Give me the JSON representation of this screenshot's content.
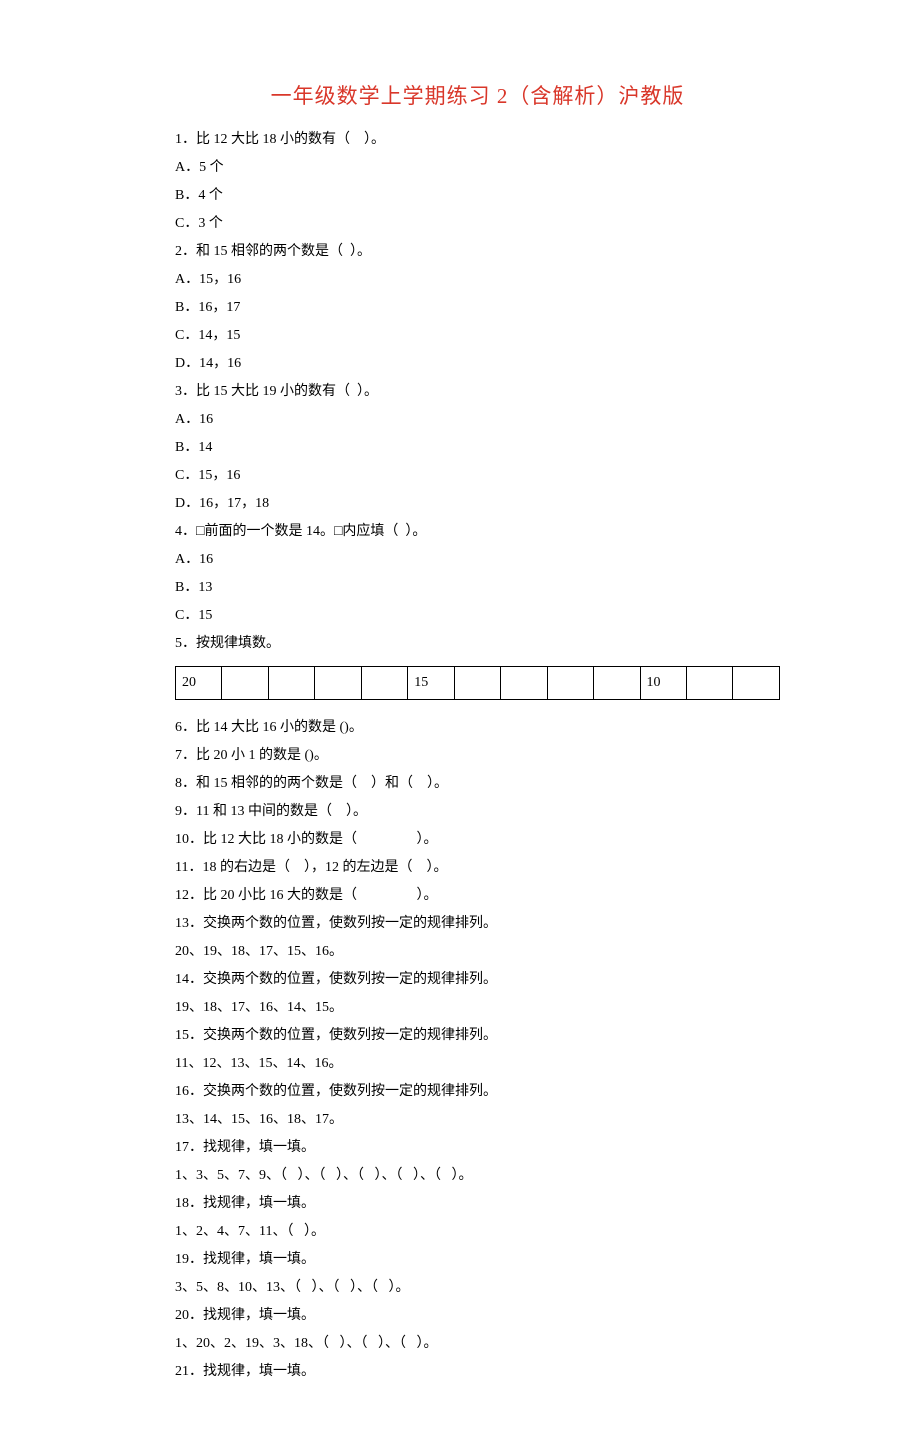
{
  "title": "一年级数学上学期练习 2（含解析）沪教版",
  "q1": {
    "stem": "1．比 12 大比 18 小的数有（    ）。",
    "a": "A．5 个",
    "b": "B．4 个",
    "c": "C．3 个"
  },
  "q2": {
    "stem": "2．和 15 相邻的两个数是（  ）。",
    "a": "A．15，16",
    "b": "B．16，17",
    "c": "C．14，15",
    "d": "D．14，16"
  },
  "q3": {
    "stem": "3．比 15 大比 19 小的数有（  ）。",
    "a": "A．16",
    "b": "B．14",
    "c": "C．15，16",
    "d": "D．16，17，18"
  },
  "q4": {
    "stem": "4．□前面的一个数是 14。□内应填（  ）。",
    "a": "A．16",
    "b": "B．13",
    "c": "C．15"
  },
  "q5": {
    "stem": "5．按规律填数。",
    "cells": [
      "20",
      "",
      "",
      "",
      "",
      "15",
      "",
      "",
      "",
      "",
      "10",
      "",
      ""
    ]
  },
  "q6": "6．比 14 大比 16 小的数是 ()。",
  "q7": "7．比 20 小 1 的数是 ()。",
  "q8": "8．和 15 相邻的的两个数是（    ）和（    ）。",
  "q9": "9．11 和 13 中间的数是（    ）。",
  "q10": "10．比 12 大比 18 小的数是（                 ）。",
  "q11": "11．18 的右边是（    ），12 的左边是（    ）。",
  "q12": "12．比 20 小比 16 大的数是（                 ）。",
  "q13a": "13．交换两个数的位置，使数列按一定的规律排列。",
  "q13b": "20、19、18、17、15、16。",
  "q14a": "14．交换两个数的位置，使数列按一定的规律排列。",
  "q14b": "19、18、17、16、14、15。",
  "q15a": "15．交换两个数的位置，使数列按一定的规律排列。",
  "q15b": "11、12、13、15、14、16。",
  "q16a": "16．交换两个数的位置，使数列按一定的规律排列。",
  "q16b": "13、14、15、16、18、17。",
  "q17a": "17．找规律，填一填。",
  "q17b": "1、3、5、7、9、（   ）、（   ）、（   ）、（   ）、（   ）。",
  "q18a": "18．找规律，填一填。",
  "q18b": "1、2、4、7、11、（   ）。",
  "q19a": "19．找规律，填一填。",
  "q19b": "3、5、8、10、13、（   ）、（   ）、（   ）。",
  "q20a": "20．找规律，填一填。",
  "q20b": "1、20、2、19、3、18、（   ）、（   ）、（   ）。",
  "q21a": "21．找规律，填一填。"
}
